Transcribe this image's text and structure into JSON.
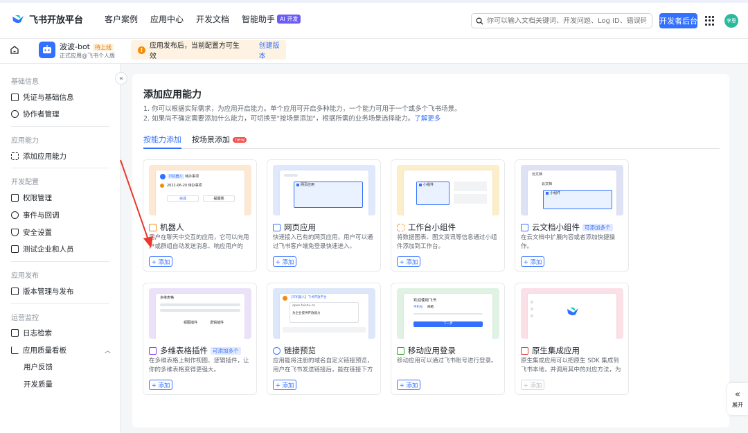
{
  "topbar": {
    "brand": "飞书开放平台",
    "nav": [
      "客户案例",
      "应用中心",
      "开发文档",
      "智能助手"
    ],
    "ai_badge": "AI 开发",
    "search_placeholder": "你可以输入文档关键词、开发问题、Log ID、错误码",
    "dev_console": "开发者后台",
    "user_initials": "李恩"
  },
  "app": {
    "name": "波波-bot",
    "status_tag": "待上线",
    "subtitle": "正式应用@飞书个人版",
    "notice": "应用发布后，当前配置方可生效",
    "notice_link": "创建版本"
  },
  "sidebar": {
    "sections": [
      {
        "title": "基础信息",
        "items": [
          "凭证与基础信息",
          "协作者管理"
        ]
      },
      {
        "title": "应用能力",
        "items": [
          "添加应用能力"
        ]
      },
      {
        "title": "开发配置",
        "items": [
          "权限管理",
          "事件与回调",
          "安全设置",
          "测试企业和人员"
        ]
      },
      {
        "title": "应用发布",
        "items": [
          "版本管理与发布"
        ]
      },
      {
        "title": "运营监控",
        "items": [
          "日志检索",
          "应用质量看板"
        ],
        "subitems": [
          "用户反馈",
          "开发质量"
        ]
      }
    ]
  },
  "main": {
    "title": "添加应用能力",
    "desc1": "1. 你可以根据实际需求，为应用开启能力。单个应用可开启多种能力，一个能力可用于一个或多个飞书场景。",
    "desc2": "2. 如果尚不确定需要添加什么能力，可切换至\"按场景添加\"，根据所需的业务场景选择能力。",
    "learn_more": "了解更多",
    "tabs": [
      "按能力添加",
      "按场景添加"
    ],
    "new_badge": "new",
    "add_label": "+ 添加",
    "multi_tag": "可添加多个",
    "cards": [
      {
        "title": "机器人",
        "desc": "用户在聊天中交互的应用，它可以向用户或群组自动发送消息、响应用户的消..."
      },
      {
        "title": "网页应用",
        "desc": "快速接入已有的网页应用，用户可以通过飞书客户端免登录快速进入。"
      },
      {
        "title": "工作台小组件",
        "desc": "将数据图表、图文资讯等信息通过小组件添加到工作台。"
      },
      {
        "title": "云文档小组件",
        "desc": "在云文档中扩展内容或者添加快捷操作。"
      },
      {
        "title": "多维表格插件",
        "desc": "在多维表格上制作视图、逻辑插件，让你的多维表格变得更强大。"
      },
      {
        "title": "链接预览",
        "desc": "应用能将注册的域名自定义链接预览，用户在飞书发送链接后，能在链接下方展示..."
      },
      {
        "title": "移动应用登录",
        "desc": "移动应用可以通过飞书账号进行登录。"
      },
      {
        "title": "原生集成应用",
        "desc": "原生集成应用可以把原生 SDK 集成到飞书本地，并调用其中的对应方法，为用户提..."
      }
    ],
    "thumb_texts": {
      "robot_tag": "IT机器人",
      "robot_tag2": "待办事项",
      "robot_line": "2022-06-20 待办事项",
      "robot_btn1": "完成",
      "robot_btn2": "提醒我",
      "web_label": "网页应用",
      "widget_label": "小组件",
      "doc_header": "云文档",
      "doc_line": "云文档",
      "doc_widget": "小组件",
      "base_header": "多维表格",
      "base_plugin1": "视图插件",
      "base_plugin2": "逻辑插件",
      "link_title": "【IT机器人】飞书开放平台",
      "link_url": "open.feishu.cn",
      "link_desc": "为企业提供开放能力",
      "mobile_title": "欢迎使用飞书",
      "mobile_tab1": "手机号",
      "mobile_tab2": "邮箱",
      "mobile_btn": "下一步"
    }
  },
  "float": {
    "label": "展开"
  }
}
